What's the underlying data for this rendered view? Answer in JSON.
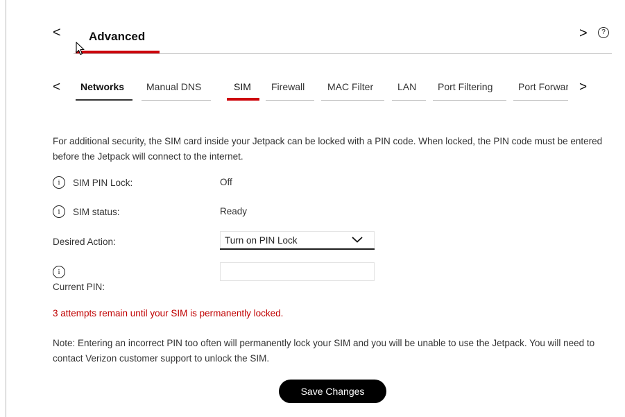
{
  "header": {
    "back_glyph": "<",
    "title": "Advanced",
    "next_glyph": ">",
    "help_glyph": "?"
  },
  "tabs": {
    "prev_glyph": "<",
    "next_glyph": ">",
    "items": [
      {
        "label": "Networks"
      },
      {
        "label": "Manual DNS"
      },
      {
        "label": "SIM"
      },
      {
        "label": "Firewall"
      },
      {
        "label": "MAC Filter"
      },
      {
        "label": "LAN"
      },
      {
        "label": "Port Filtering"
      },
      {
        "label": "Port Forwarding"
      }
    ]
  },
  "sim": {
    "intro": "For additional security, the SIM card inside your Jetpack can be locked with a PIN code. When locked, the PIN code must be entered before the Jetpack will connect to the internet.",
    "info_glyph": "i",
    "pin_lock_label": "SIM PIN Lock:",
    "pin_lock_value": "Off",
    "status_label": "SIM status:",
    "status_value": "Ready",
    "action_label": "Desired Action:",
    "action_value": "Turn on PIN Lock",
    "current_pin_label": "Current PIN:",
    "current_pin_value": "",
    "attempts_warning": "3 attempts remain until your SIM is permanently locked.",
    "note": "Note: Entering an incorrect PIN too often will permanently lock your SIM and you will be unable to use the Jetpack. You will need to contact Verizon customer support to unlock the SIM.",
    "save_label": "Save Changes"
  },
  "colors": {
    "accent_red": "#cd040b",
    "warning_red": "#c00000",
    "button_bg": "#000000"
  }
}
